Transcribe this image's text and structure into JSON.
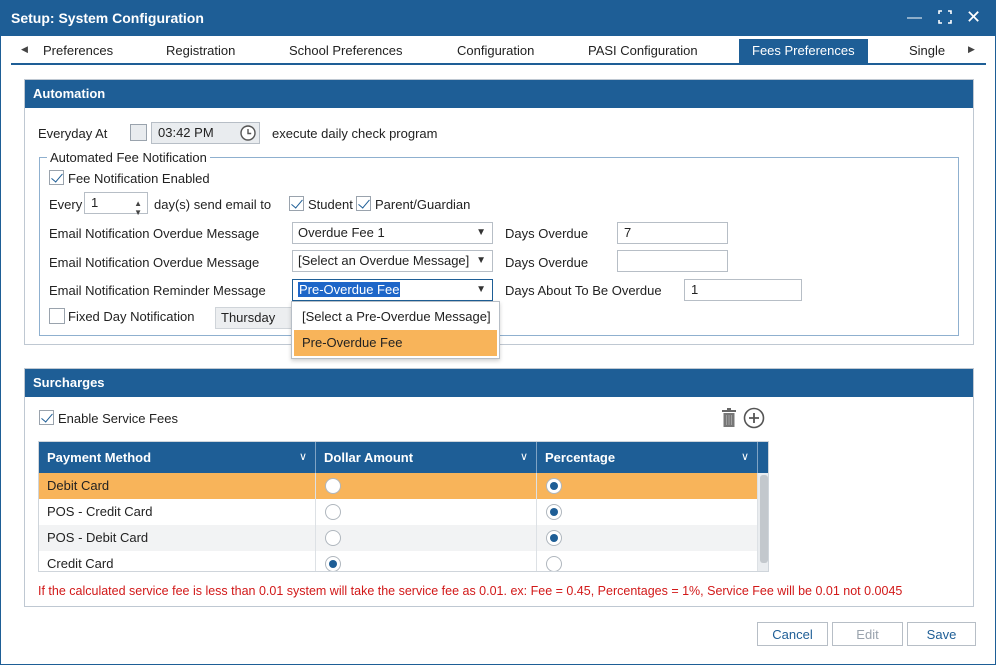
{
  "window": {
    "title": "Setup: System Configuration"
  },
  "tabs": [
    {
      "label": "Preferences",
      "active": false
    },
    {
      "label": "Registration",
      "active": false
    },
    {
      "label": "School Preferences",
      "active": false
    },
    {
      "label": "Configuration",
      "active": false
    },
    {
      "label": "PASI Configuration",
      "active": false
    },
    {
      "label": "Fees Preferences",
      "active": true
    },
    {
      "label": "Single",
      "active": false
    }
  ],
  "automation": {
    "header": "Automation",
    "everyday_label": "Everyday At",
    "time_value": "03:42 PM",
    "execute_label": "execute daily check program",
    "group_legend": "Automated Fee Notification",
    "fee_notification_enabled_label": "Fee Notification Enabled",
    "fee_notification_enabled": true,
    "every_label": "Every",
    "every_value": "1",
    "days_send_label": "day(s) send email to",
    "student_label": "Student",
    "student_checked": true,
    "parent_label": "Parent/Guardian",
    "parent_checked": true,
    "overdue_msg_label_1": "Email Notification Overdue Message",
    "overdue_msg_value_1": "Overdue Fee 1",
    "days_overdue_label_1": "Days Overdue",
    "days_overdue_value_1": "7",
    "overdue_msg_label_2": "Email Notification Overdue Message",
    "overdue_msg_value_2": "[Select an Overdue Message]",
    "days_overdue_label_2": "Days Overdue",
    "days_overdue_value_2": "",
    "reminder_msg_label": "Email Notification Reminder Message",
    "reminder_msg_value": "Pre-Overdue Fee",
    "days_about_label": "Days About To Be Overdue",
    "days_about_value": "1",
    "fixed_day_label": "Fixed Day Notification",
    "fixed_day_value": "Thursday",
    "reminder_options": [
      "[Select a Pre-Overdue Message]",
      "Pre-Overdue Fee"
    ]
  },
  "surcharges": {
    "header": "Surcharges",
    "enable_service_fees_label": "Enable Service Fees",
    "enable_service_fees": true,
    "columns": [
      "Payment Method",
      "Dollar Amount",
      "Percentage"
    ],
    "rows": [
      {
        "method": "Debit Card",
        "dollar": false,
        "percentage": true
      },
      {
        "method": "POS - Credit Card",
        "dollar": false,
        "percentage": true
      },
      {
        "method": "POS - Debit Card",
        "dollar": false,
        "percentage": true
      },
      {
        "method": "Credit Card",
        "dollar": true,
        "percentage": false
      }
    ],
    "warning": "If the calculated service fee is less than 0.01 system will take the service fee as 0.01. ex: Fee = 0.45, Percentages = 1%, Service Fee will be 0.01 not 0.0045"
  },
  "buttons": {
    "cancel": "Cancel",
    "edit": "Edit",
    "save": "Save"
  },
  "colors": {
    "primary": "#1e5e96",
    "selected_row": "#f8b45a",
    "warning": "#d21919"
  }
}
